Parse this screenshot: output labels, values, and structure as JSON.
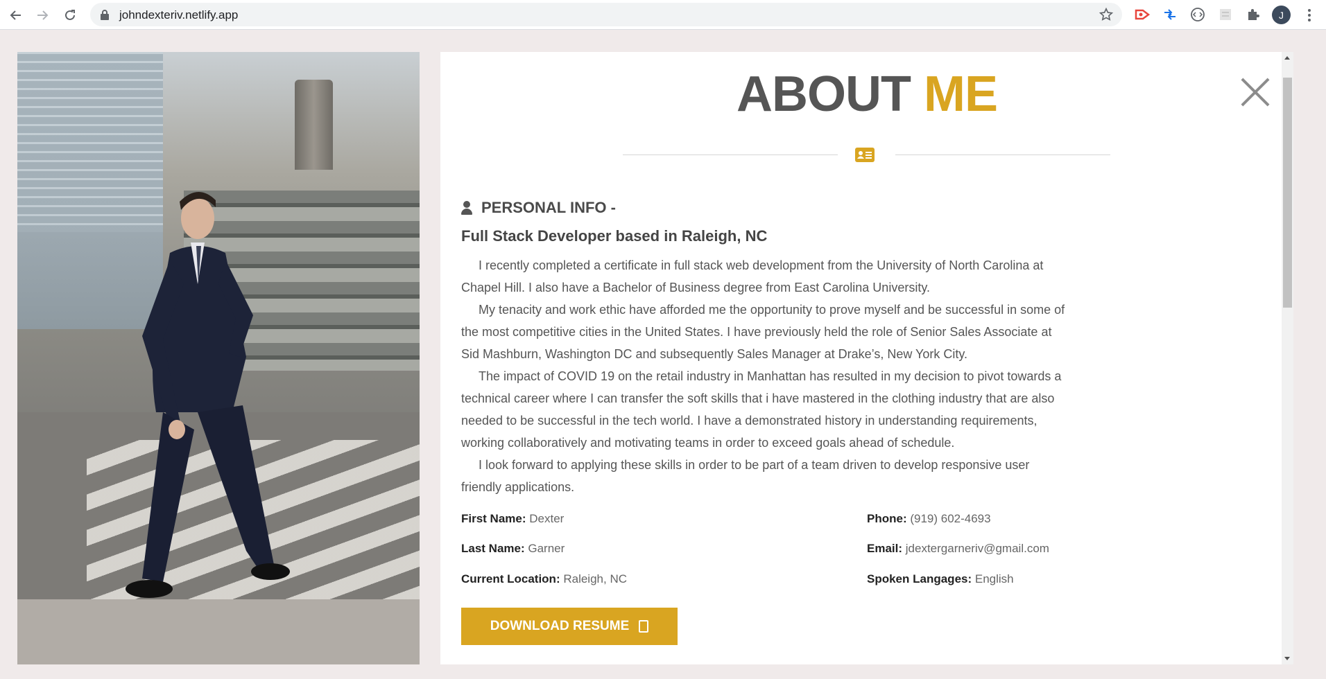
{
  "browser": {
    "url": "johndexteriv.netlify.app",
    "profile_initial": "J",
    "icons": {
      "back": "arrow-left-icon",
      "forward": "arrow-right-icon",
      "reload": "reload-icon",
      "lock": "lock-icon",
      "bookmark": "star-icon",
      "extensions": "puzzle-icon"
    }
  },
  "about": {
    "heading_part1": "ABOUT",
    "heading_part2": "ME",
    "section_title": "PERSONAL INFO -",
    "subtitle": "Full Stack Developer based in Raleigh, NC",
    "paragraphs": [
      "I recently completed a certificate in full stack web development from the University of North Carolina at Chapel Hill. I also have a Bachelor of Business degree from East Carolina University.",
      "My tenacity and work ethic have afforded me the opportunity to prove myself and be successful in some of the most competitive cities in the United States. I have previously held the role of Senior Sales Associate at Sid Mashburn, Washington DC and subsequently Sales Manager at Drake’s, New York City.",
      "The impact of COVID 19 on the retail industry in Manhattan has resulted in my decision to pivot towards a technical career where I can transfer the soft skills that i have mastered in the clothing industry that are also needed to be successful in the tech world. I have a demonstrated history in understanding requirements, working collaboratively and motivating teams in order to exceed goals ahead of schedule.",
      "I look forward to applying these skills in order to be part of a team driven to develop responsive user friendly applications."
    ],
    "info": {
      "first_name_label": "First Name:",
      "first_name": "Dexter",
      "last_name_label": "Last Name:",
      "last_name": "Garner",
      "location_label": "Current Location:",
      "location": "Raleigh, NC",
      "phone_label": "Phone:",
      "phone": "(919) 602-4693",
      "email_label": "Email:",
      "email": "jdextergarneriv@gmail.com",
      "languages_label": "Spoken Langages:",
      "languages": "English"
    },
    "download_label": "DOWNLOAD RESUME"
  },
  "colors": {
    "accent": "#d9a521",
    "heading_gray": "#555555",
    "page_bg": "#f0eaea"
  }
}
